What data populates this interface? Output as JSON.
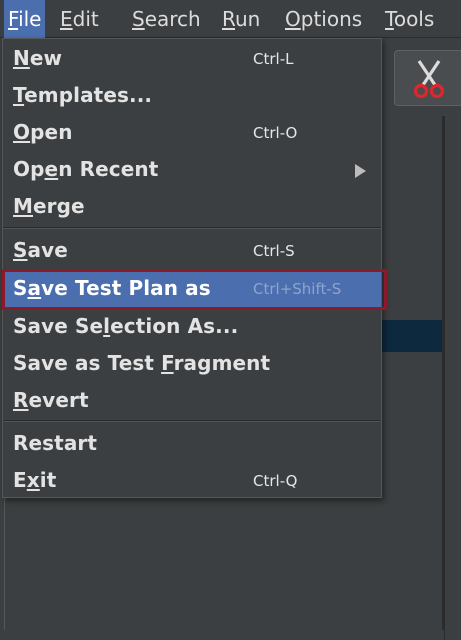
{
  "menubar": {
    "items": [
      {
        "label": "File",
        "mnemonic": "F",
        "active": true
      },
      {
        "label": "Edit",
        "mnemonic": "E",
        "active": false
      },
      {
        "label": "Search",
        "mnemonic": "S",
        "active": false
      },
      {
        "label": "Run",
        "mnemonic": "R",
        "active": false
      },
      {
        "label": "Options",
        "mnemonic": "O",
        "active": false
      },
      {
        "label": "Tools",
        "mnemonic": "T",
        "active": false
      }
    ]
  },
  "toolbar": {
    "cut_icon": "scissors-icon"
  },
  "file_menu": {
    "items": [
      {
        "pre": "",
        "mn": "N",
        "post": "ew",
        "shortcut": "Ctrl-L"
      },
      {
        "pre": "",
        "mn": "T",
        "post": "emplates...",
        "shortcut": ""
      },
      {
        "pre": "",
        "mn": "O",
        "post": "pen",
        "shortcut": "Ctrl-O"
      },
      {
        "pre": "Op",
        "mn": "e",
        "post": "n Recent",
        "shortcut": "",
        "submenu": true
      },
      {
        "pre": "",
        "mn": "M",
        "post": "erge",
        "shortcut": ""
      },
      {
        "pre": "",
        "mn": "S",
        "post": "ave",
        "shortcut": "Ctrl-S"
      },
      {
        "pre": "S",
        "mn": "a",
        "post": "ve Test Plan as",
        "shortcut": "Ctrl+Shift-S",
        "highlighted": true
      },
      {
        "pre": "Save Se",
        "mn": "l",
        "post": "ection As...",
        "shortcut": ""
      },
      {
        "pre": "Save as Test ",
        "mn": "F",
        "post": "ragment",
        "shortcut": ""
      },
      {
        "pre": "",
        "mn": "R",
        "post": "evert",
        "shortcut": ""
      },
      {
        "pre": "Restart",
        "mn": "",
        "post": "",
        "shortcut": ""
      },
      {
        "pre": "E",
        "mn": "x",
        "post": "it",
        "shortcut": "Ctrl-Q"
      }
    ]
  },
  "colors": {
    "background": "#3c3f41",
    "selection": "#4b6eaf",
    "annotation_frame": "#8b1a2a",
    "tree_selection": "#0d293e",
    "scissors": "#e0262a"
  }
}
